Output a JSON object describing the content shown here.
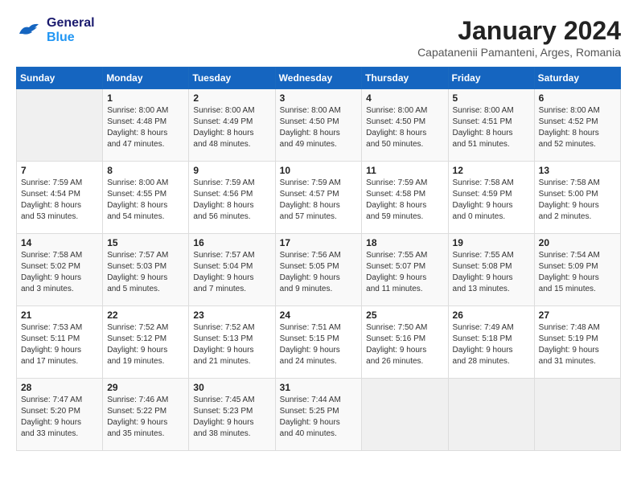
{
  "logo": {
    "line1": "General",
    "line2": "Blue"
  },
  "title": "January 2024",
  "subtitle": "Capatanenii Pamanteni, Arges, Romania",
  "header": {
    "days": [
      "Sunday",
      "Monday",
      "Tuesday",
      "Wednesday",
      "Thursday",
      "Friday",
      "Saturday"
    ]
  },
  "weeks": [
    {
      "days": [
        {
          "num": "",
          "info": ""
        },
        {
          "num": "1",
          "info": "Sunrise: 8:00 AM\nSunset: 4:48 PM\nDaylight: 8 hours\nand 47 minutes."
        },
        {
          "num": "2",
          "info": "Sunrise: 8:00 AM\nSunset: 4:49 PM\nDaylight: 8 hours\nand 48 minutes."
        },
        {
          "num": "3",
          "info": "Sunrise: 8:00 AM\nSunset: 4:50 PM\nDaylight: 8 hours\nand 49 minutes."
        },
        {
          "num": "4",
          "info": "Sunrise: 8:00 AM\nSunset: 4:50 PM\nDaylight: 8 hours\nand 50 minutes."
        },
        {
          "num": "5",
          "info": "Sunrise: 8:00 AM\nSunset: 4:51 PM\nDaylight: 8 hours\nand 51 minutes."
        },
        {
          "num": "6",
          "info": "Sunrise: 8:00 AM\nSunset: 4:52 PM\nDaylight: 8 hours\nand 52 minutes."
        }
      ]
    },
    {
      "days": [
        {
          "num": "7",
          "info": "Sunrise: 7:59 AM\nSunset: 4:54 PM\nDaylight: 8 hours\nand 53 minutes."
        },
        {
          "num": "8",
          "info": "Sunrise: 8:00 AM\nSunset: 4:55 PM\nDaylight: 8 hours\nand 54 minutes."
        },
        {
          "num": "9",
          "info": "Sunrise: 7:59 AM\nSunset: 4:56 PM\nDaylight: 8 hours\nand 56 minutes."
        },
        {
          "num": "10",
          "info": "Sunrise: 7:59 AM\nSunset: 4:57 PM\nDaylight: 8 hours\nand 57 minutes."
        },
        {
          "num": "11",
          "info": "Sunrise: 7:59 AM\nSunset: 4:58 PM\nDaylight: 8 hours\nand 59 minutes."
        },
        {
          "num": "12",
          "info": "Sunrise: 7:58 AM\nSunset: 4:59 PM\nDaylight: 9 hours\nand 0 minutes."
        },
        {
          "num": "13",
          "info": "Sunrise: 7:58 AM\nSunset: 5:00 PM\nDaylight: 9 hours\nand 2 minutes."
        }
      ]
    },
    {
      "days": [
        {
          "num": "14",
          "info": "Sunrise: 7:58 AM\nSunset: 5:02 PM\nDaylight: 9 hours\nand 3 minutes."
        },
        {
          "num": "15",
          "info": "Sunrise: 7:57 AM\nSunset: 5:03 PM\nDaylight: 9 hours\nand 5 minutes."
        },
        {
          "num": "16",
          "info": "Sunrise: 7:57 AM\nSunset: 5:04 PM\nDaylight: 9 hours\nand 7 minutes."
        },
        {
          "num": "17",
          "info": "Sunrise: 7:56 AM\nSunset: 5:05 PM\nDaylight: 9 hours\nand 9 minutes."
        },
        {
          "num": "18",
          "info": "Sunrise: 7:55 AM\nSunset: 5:07 PM\nDaylight: 9 hours\nand 11 minutes."
        },
        {
          "num": "19",
          "info": "Sunrise: 7:55 AM\nSunset: 5:08 PM\nDaylight: 9 hours\nand 13 minutes."
        },
        {
          "num": "20",
          "info": "Sunrise: 7:54 AM\nSunset: 5:09 PM\nDaylight: 9 hours\nand 15 minutes."
        }
      ]
    },
    {
      "days": [
        {
          "num": "21",
          "info": "Sunrise: 7:53 AM\nSunset: 5:11 PM\nDaylight: 9 hours\nand 17 minutes."
        },
        {
          "num": "22",
          "info": "Sunrise: 7:52 AM\nSunset: 5:12 PM\nDaylight: 9 hours\nand 19 minutes."
        },
        {
          "num": "23",
          "info": "Sunrise: 7:52 AM\nSunset: 5:13 PM\nDaylight: 9 hours\nand 21 minutes."
        },
        {
          "num": "24",
          "info": "Sunrise: 7:51 AM\nSunset: 5:15 PM\nDaylight: 9 hours\nand 24 minutes."
        },
        {
          "num": "25",
          "info": "Sunrise: 7:50 AM\nSunset: 5:16 PM\nDaylight: 9 hours\nand 26 minutes."
        },
        {
          "num": "26",
          "info": "Sunrise: 7:49 AM\nSunset: 5:18 PM\nDaylight: 9 hours\nand 28 minutes."
        },
        {
          "num": "27",
          "info": "Sunrise: 7:48 AM\nSunset: 5:19 PM\nDaylight: 9 hours\nand 31 minutes."
        }
      ]
    },
    {
      "days": [
        {
          "num": "28",
          "info": "Sunrise: 7:47 AM\nSunset: 5:20 PM\nDaylight: 9 hours\nand 33 minutes."
        },
        {
          "num": "29",
          "info": "Sunrise: 7:46 AM\nSunset: 5:22 PM\nDaylight: 9 hours\nand 35 minutes."
        },
        {
          "num": "30",
          "info": "Sunrise: 7:45 AM\nSunset: 5:23 PM\nDaylight: 9 hours\nand 38 minutes."
        },
        {
          "num": "31",
          "info": "Sunrise: 7:44 AM\nSunset: 5:25 PM\nDaylight: 9 hours\nand 40 minutes."
        },
        {
          "num": "",
          "info": ""
        },
        {
          "num": "",
          "info": ""
        },
        {
          "num": "",
          "info": ""
        }
      ]
    }
  ]
}
